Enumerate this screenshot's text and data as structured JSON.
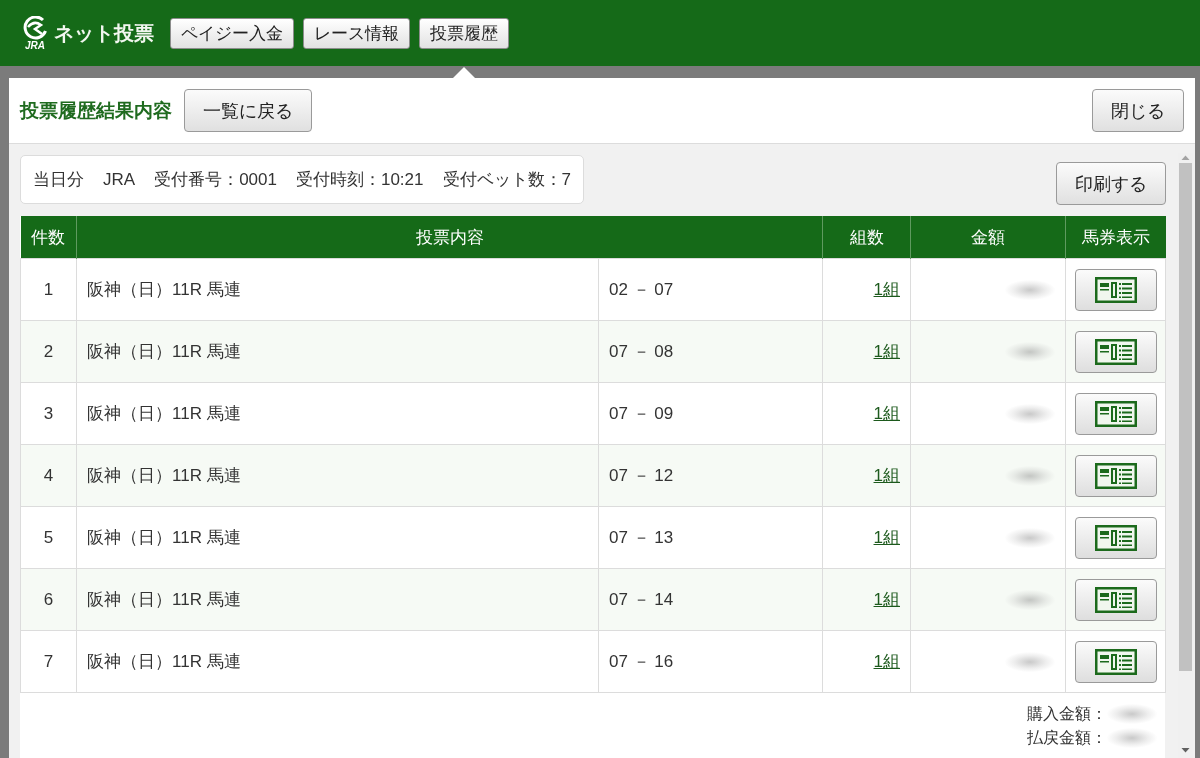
{
  "header": {
    "logo": {
      "mark": "JRA",
      "title": "ネット投票"
    },
    "nav": [
      {
        "label": "ペイジー入金",
        "selected": false
      },
      {
        "label": "レース情報",
        "selected": false
      },
      {
        "label": "投票履歴",
        "selected": true
      }
    ]
  },
  "dialog": {
    "title": "投票履歴結果内容",
    "back_button": "一覧に戻る",
    "close_button": "閉じる"
  },
  "receipt_info": [
    "当日分",
    "JRA",
    "受付番号：0001",
    "受付時刻：10:21",
    "受付ベット数：7"
  ],
  "print_button": "印刷する",
  "table": {
    "columns": [
      "件数",
      "投票内容",
      "組数",
      "金額",
      "馬券表示"
    ],
    "rows": [
      {
        "number": "1",
        "race": "阪神（日）11R 馬連",
        "horses": "02 － 07",
        "combinations": "1組"
      },
      {
        "number": "2",
        "race": "阪神（日）11R 馬連",
        "horses": "07 － 08",
        "combinations": "1組"
      },
      {
        "number": "3",
        "race": "阪神（日）11R 馬連",
        "horses": "07 － 09",
        "combinations": "1組"
      },
      {
        "number": "4",
        "race": "阪神（日）11R 馬連",
        "horses": "07 － 12",
        "combinations": "1組"
      },
      {
        "number": "5",
        "race": "阪神（日）11R 馬連",
        "horses": "07 － 13",
        "combinations": "1組"
      },
      {
        "number": "6",
        "race": "阪神（日）11R 馬連",
        "horses": "07 － 14",
        "combinations": "1組"
      },
      {
        "number": "7",
        "race": "阪神（日）11R 馬連",
        "horses": "07 － 16",
        "combinations": "1組"
      }
    ]
  },
  "totals": [
    {
      "label": "購入金額："
    },
    {
      "label": "払戻金額："
    }
  ]
}
